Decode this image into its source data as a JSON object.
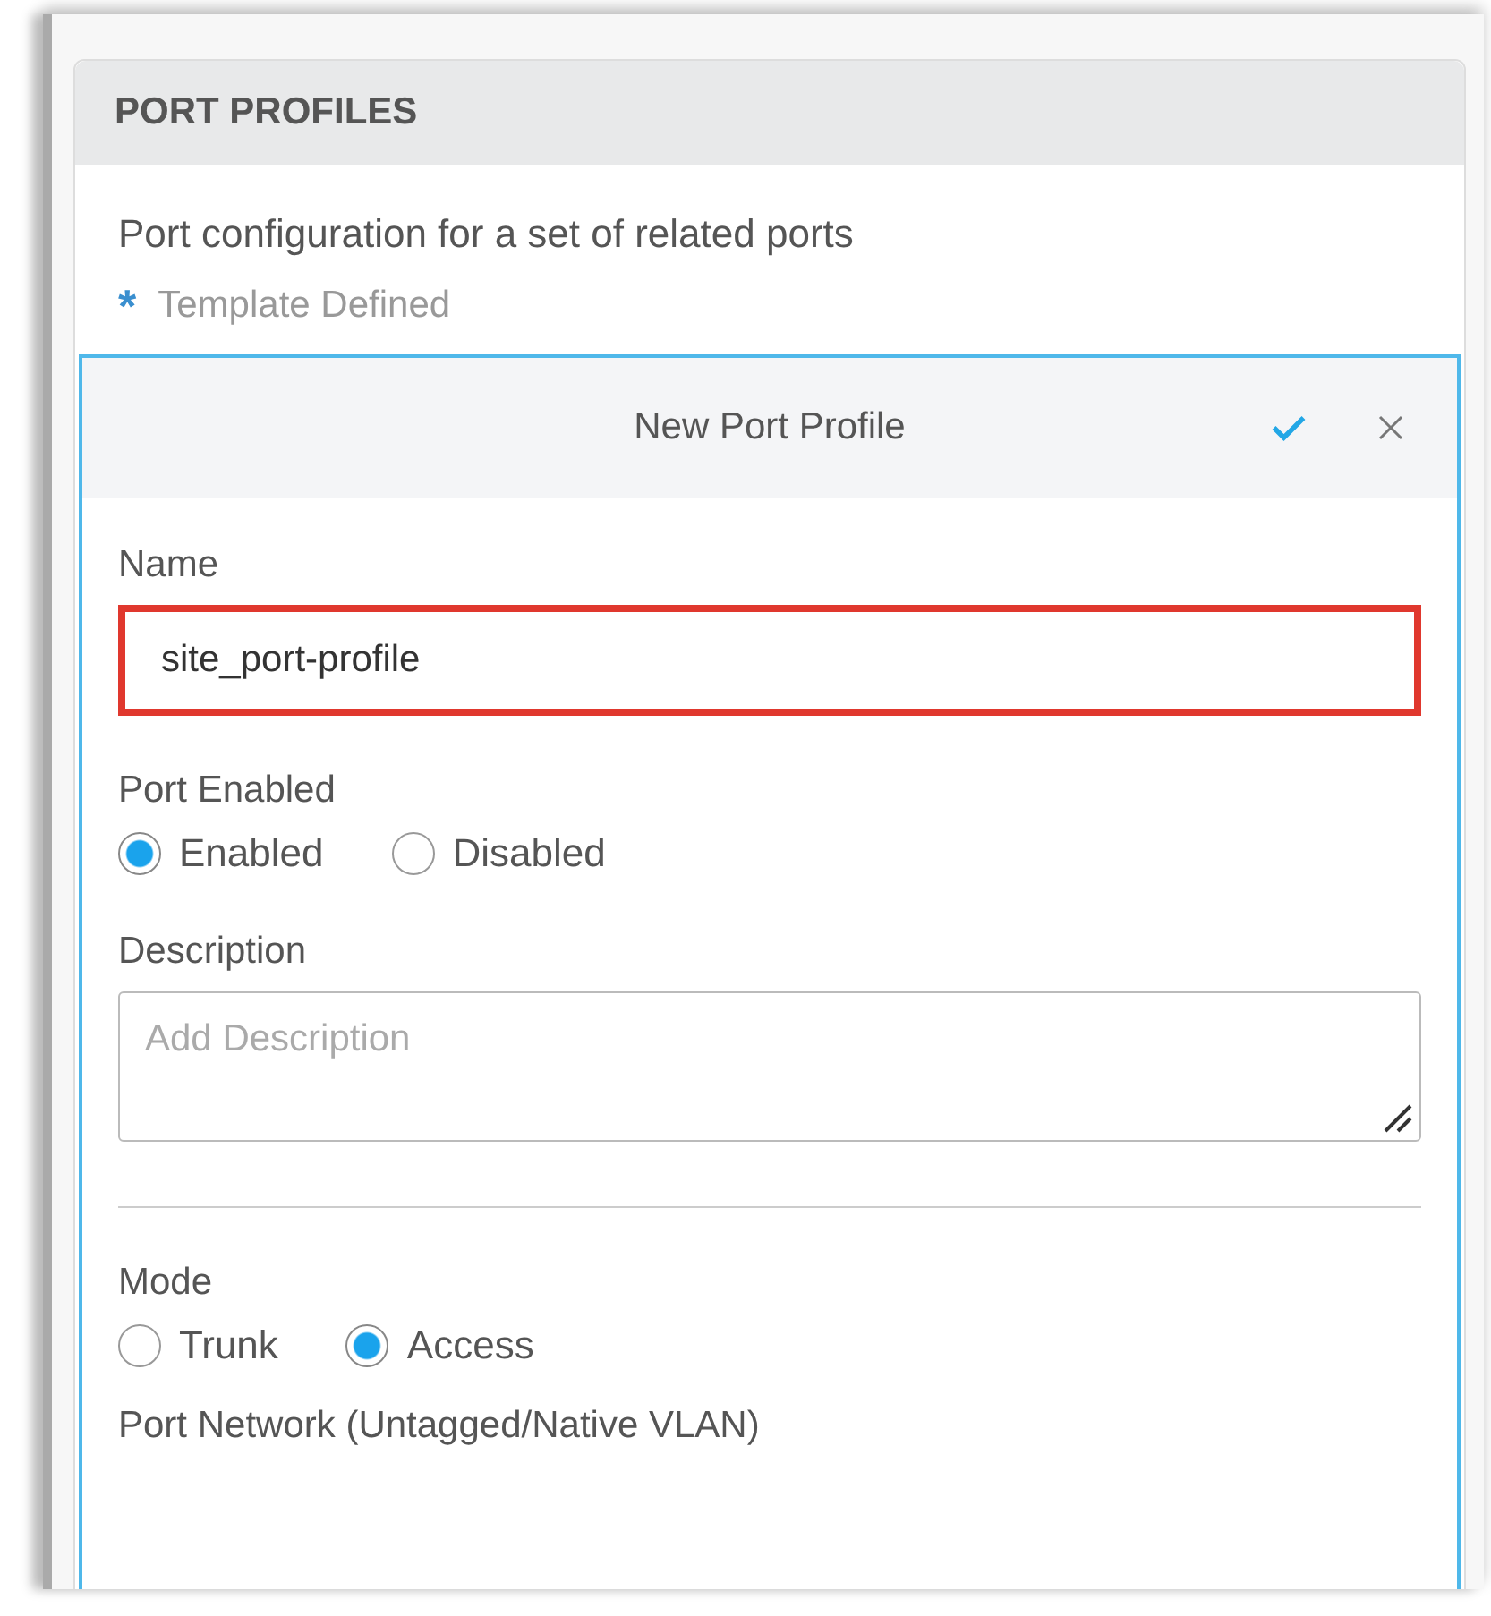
{
  "panel": {
    "title": "PORT PROFILES",
    "description": "Port configuration for a set of related ports",
    "legend_mark": "*",
    "legend": "Template Defined"
  },
  "editor": {
    "title": "New Port Profile",
    "name_field": {
      "label": "Name",
      "value": "site_port-profile",
      "highlighted": true
    },
    "port_enabled": {
      "label": "Port Enabled",
      "options": [
        {
          "label": "Enabled",
          "selected": true
        },
        {
          "label": "Disabled",
          "selected": false
        }
      ]
    },
    "description_field": {
      "label": "Description",
      "placeholder": "Add Description"
    },
    "mode": {
      "label": "Mode",
      "options": [
        {
          "label": "Trunk",
          "selected": false
        },
        {
          "label": "Access",
          "selected": true
        }
      ]
    },
    "next_label": "Port Network (Untagged/Native VLAN)"
  }
}
